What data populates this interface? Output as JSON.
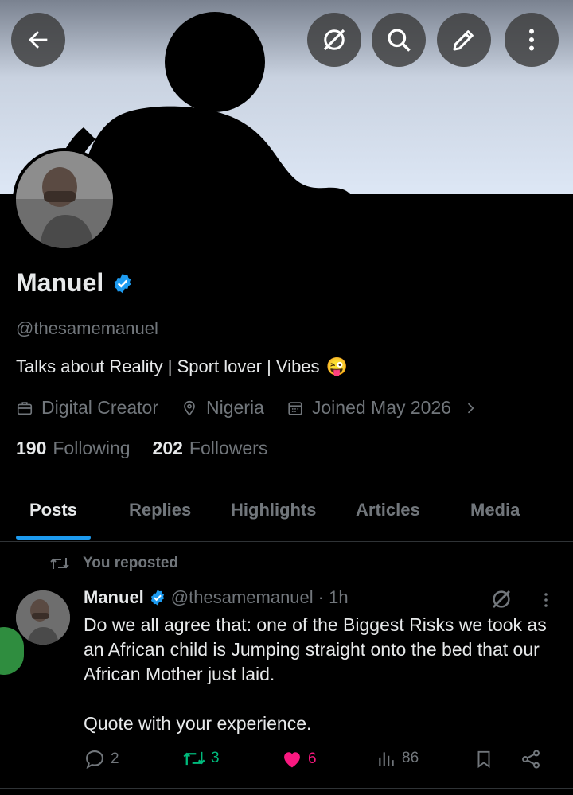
{
  "header": {
    "back_icon": "arrow-left-icon",
    "actions": [
      "grok-icon",
      "search-icon",
      "edit-icon",
      "more-vertical-icon"
    ]
  },
  "profile": {
    "name": "Manuel",
    "handle": "@thesamemanuel",
    "bio": "Talks about Reality | Sport lover | Vibes",
    "bio_emoji": "😜",
    "category": "Digital Creator",
    "location": "Nigeria",
    "joined": "Joined May 2026",
    "following_count": "190",
    "following_label": "Following",
    "followers_count": "202",
    "followers_label": "Followers"
  },
  "tabs": [
    {
      "label": "Posts",
      "active": true
    },
    {
      "label": "Replies",
      "active": false
    },
    {
      "label": "Highlights",
      "active": false
    },
    {
      "label": "Articles",
      "active": false
    },
    {
      "label": "Media",
      "active": false
    }
  ],
  "post": {
    "repost_label": "You reposted",
    "author_name": "Manuel",
    "author_handle": "@thesamemanuel",
    "time": "· 1h",
    "text_lines": [
      "Do we all agree that: one of the Biggest Risks we  took as an African child is Jumping straight onto the bed that our African Mother just laid.",
      "Quote with your experience."
    ],
    "replies": "2",
    "reposts": "3",
    "likes": "6",
    "views": "86"
  },
  "colors": {
    "accent": "#1d9bf0",
    "repost_green": "#00ba7c",
    "like_pink": "#f91880",
    "muted": "#71767b"
  }
}
